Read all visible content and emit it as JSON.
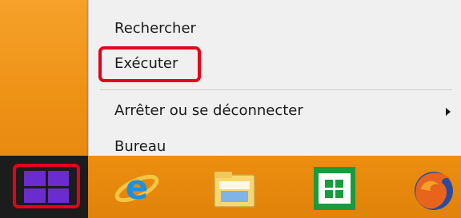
{
  "context_menu": {
    "items": [
      {
        "label": "Rechercher"
      },
      {
        "label": "Exécuter"
      },
      {
        "label": "Arrêter ou se déconnecter"
      },
      {
        "label": "Bureau"
      }
    ]
  },
  "taskbar": {
    "icons": [
      "windows-start-icon",
      "internet-explorer-icon",
      "file-explorer-icon",
      "windows-store-icon",
      "firefox-icon"
    ]
  },
  "colors": {
    "highlight": "#e5001c",
    "windows_logo": "#6a2bcf",
    "desktop": "#f39b1c",
    "menu_background": "#f0f0f0"
  }
}
